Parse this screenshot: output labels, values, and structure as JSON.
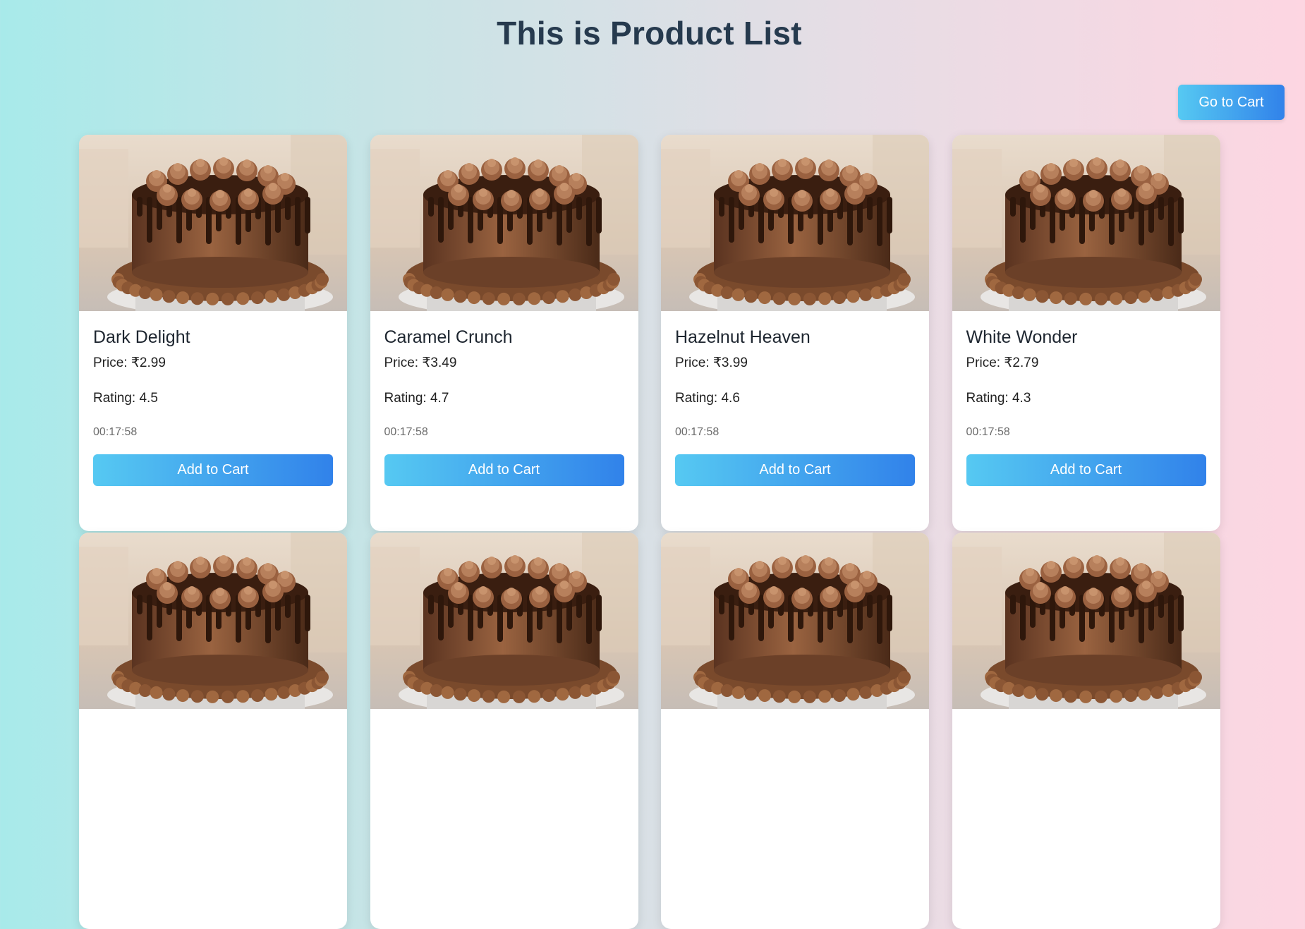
{
  "header": {
    "title": "This is Product List",
    "go_to_cart_label": "Go to Cart"
  },
  "colors": {
    "background_left": "#a8eaea",
    "background_right": "#fdd6e2",
    "title": "#263a4e",
    "button_start": "#56c9f2",
    "button_end": "#3182ea"
  },
  "products": [
    {
      "name": "Dark Delight",
      "price": "Price: ₹2.99",
      "rating": "Rating: 4.5",
      "timer": "00:17:58",
      "button": "Add to Cart",
      "image": "chocolate-drip-cake-image"
    },
    {
      "name": "Caramel Crunch",
      "price": "Price: ₹3.49",
      "rating": "Rating: 4.7",
      "timer": "00:17:58",
      "button": "Add to Cart",
      "image": "chocolate-drip-cake-image"
    },
    {
      "name": "Hazelnut Heaven",
      "price": "Price: ₹3.99",
      "rating": "Rating: 4.6",
      "timer": "00:17:58",
      "button": "Add to Cart",
      "image": "chocolate-drip-cake-image"
    },
    {
      "name": "White Wonder",
      "price": "Price: ₹2.79",
      "rating": "Rating: 4.3",
      "timer": "00:17:58",
      "button": "Add to Cart",
      "image": "chocolate-drip-cake-image"
    }
  ],
  "second_row_partial_cards": 4
}
